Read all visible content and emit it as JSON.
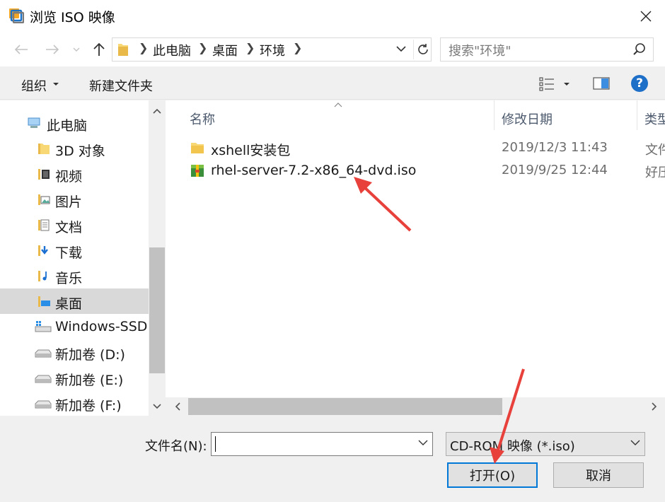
{
  "window": {
    "title": "浏览 ISO 映像",
    "app_icon": "vmware-icon",
    "close_icon": "close-icon"
  },
  "address": {
    "crumbs": [
      "此电脑",
      "桌面",
      "环境"
    ],
    "search_placeholder": "搜索\"环境\""
  },
  "toolbar": {
    "organize": "组织",
    "new_folder": "新建文件夹",
    "help": "?"
  },
  "nav": {
    "items": [
      {
        "label": "此电脑",
        "icon": "computer-icon"
      },
      {
        "label": "3D 对象",
        "icon": "folder-3d-icon"
      },
      {
        "label": "视频",
        "icon": "folder-video-icon"
      },
      {
        "label": "图片",
        "icon": "folder-pictures-icon"
      },
      {
        "label": "文档",
        "icon": "folder-documents-icon"
      },
      {
        "label": "下载",
        "icon": "folder-downloads-icon"
      },
      {
        "label": "音乐",
        "icon": "folder-music-icon"
      },
      {
        "label": "桌面",
        "icon": "folder-desktop-icon",
        "selected": true
      },
      {
        "label": "Windows-SSD (",
        "icon": "windows-drive-icon"
      },
      {
        "label": "新加卷 (D:)",
        "icon": "drive-icon"
      },
      {
        "label": "新加卷 (E:)",
        "icon": "drive-icon"
      },
      {
        "label": "新加卷 (F:)",
        "icon": "drive-icon"
      }
    ]
  },
  "columns": {
    "name": "名称",
    "modified": "修改日期",
    "type": "类型"
  },
  "files": [
    {
      "name": "xshell安装包",
      "modified": "2019/12/3 11:43",
      "type": "文件",
      "icon": "folder-icon"
    },
    {
      "name": "rhel-server-7.2-x86_64-dvd.iso",
      "modified": "2019/9/25 12:44",
      "type": "好压",
      "icon": "archive-icon"
    }
  ],
  "bottom": {
    "filename_label": "文件名(N):",
    "filename_value": "",
    "filter_value": "CD-ROM 映像 (*.iso)",
    "open_label": "打开(O)",
    "cancel_label": "取消"
  },
  "annotation_color": "#e8403a"
}
